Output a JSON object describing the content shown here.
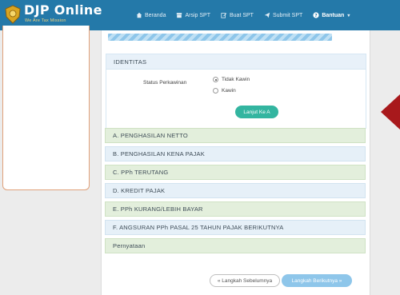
{
  "header": {
    "brand_title": "DJP Online",
    "brand_subtitle": "We Are Tax Mission",
    "nav": [
      {
        "label": "Beranda",
        "icon": "home-icon"
      },
      {
        "label": "Arsip SPT",
        "icon": "archive-icon"
      },
      {
        "label": "Buat SPT",
        "icon": "edit-icon"
      },
      {
        "label": "Submit SPT",
        "icon": "send-icon"
      },
      {
        "label": "Bantuan",
        "icon": "help-icon"
      }
    ]
  },
  "identitas": {
    "title": "IDENTITAS",
    "status_label": "Status Perkawinan",
    "options": [
      {
        "label": "Tidak Kawin",
        "checked": true
      },
      {
        "label": "Kawin",
        "checked": false
      }
    ],
    "next_button": "Lanjut Ke A"
  },
  "sections": [
    "A. PENGHASILAN NETTO",
    "B. PENGHASILAN KENA PAJAK",
    "C. PPh TERUTANG",
    "D. KREDIT PAJAK",
    "E. PPh KURANG/LEBIH BAYAR",
    "F. ANGSURAN PPh PASAL 25 TAHUN PAJAK BERIKUTNYA",
    "Pernyataan"
  ],
  "footer": {
    "prev_button": "« Langkah Sebelumnya",
    "next_button": "Langkah Berikutnya »"
  },
  "colors": {
    "header_bg": "#2479a9",
    "accent_teal": "#33b5a0",
    "section_green": "#e3efdc",
    "section_blue": "#e6f0f8",
    "pointer_red": "#a8191c"
  }
}
